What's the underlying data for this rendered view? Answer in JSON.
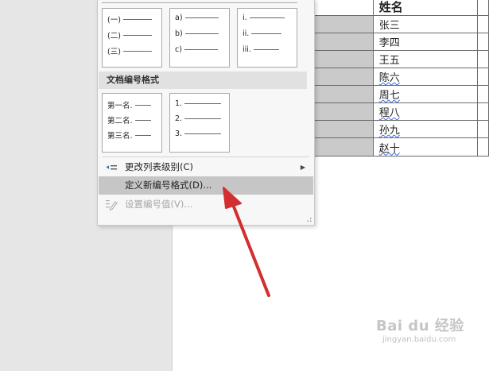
{
  "document": {
    "header_name": "姓名",
    "rows": [
      "张三",
      "李四",
      "王五",
      "陈六",
      "周七",
      "程八",
      "孙九",
      "赵十"
    ],
    "squiggle_rows": [
      3,
      4,
      5,
      6,
      7
    ]
  },
  "menu": {
    "top_swatches": [
      {
        "lines": [
          "(一)",
          "(二)",
          "(三)"
        ]
      },
      {
        "lines": [
          "a)",
          "b)",
          "c)"
        ]
      },
      {
        "lines": [
          "i.",
          "ii.",
          "iii."
        ]
      }
    ],
    "section_title": "文档编号格式",
    "doc_swatches": [
      {
        "lines": [
          "第一名.",
          "第二名.",
          "第三名."
        ]
      },
      {
        "lines": [
          "1.",
          "2.",
          "3."
        ]
      }
    ],
    "items": {
      "change_level": {
        "label": "更改列表级别(C)",
        "icon": "list-level-icon"
      },
      "define_format": {
        "label": "定义新编号格式(D)...",
        "icon": ""
      },
      "set_value": {
        "label": "设置编号值(V)...",
        "icon": "set-number-value-icon"
      }
    }
  },
  "watermark": {
    "brand": "Bai du 经验",
    "url": "jingyan.baidu.com"
  },
  "colors": {
    "annotation_arrow": "#d32f2f",
    "highlight": "#c6c6c6",
    "table_shade": "#cacaca"
  }
}
